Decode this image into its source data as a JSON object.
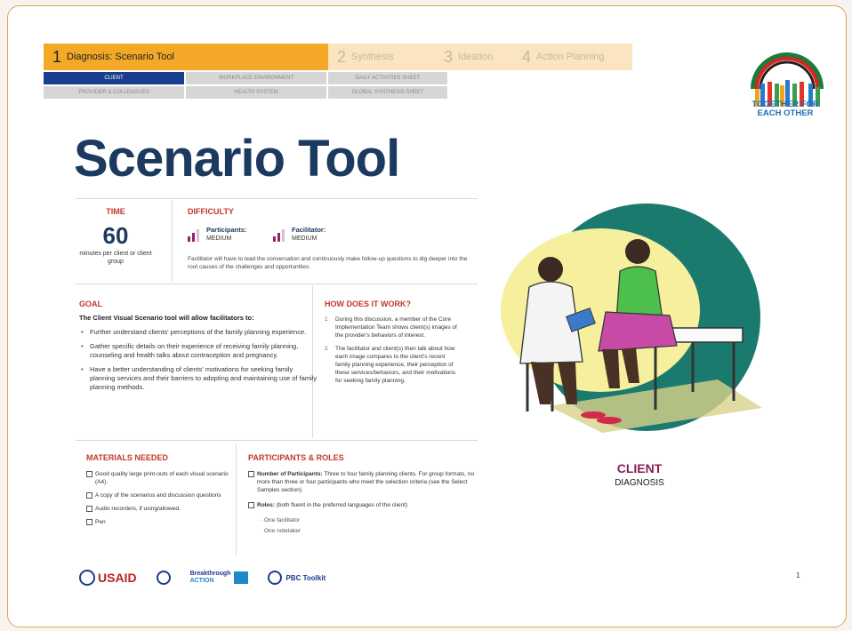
{
  "nav": {
    "steps": [
      {
        "num": "1",
        "label": "Diagnosis: Scenario Tool"
      },
      {
        "num": "2",
        "label": "Synthesis"
      },
      {
        "num": "3",
        "label": "Ideation"
      },
      {
        "num": "4",
        "label": "Action Planning"
      }
    ],
    "tabs_row1": [
      "CLIENT",
      "WORKPLACE ENVIRONMENT",
      "DAILY ACTIVITIES SHEET"
    ],
    "tabs_row2": [
      "PROVIDER & COLLEAGUES",
      "HEALTH SYSTEM",
      "GLOBAL SYNTHESIS SHEET"
    ]
  },
  "logo": {
    "line1": "TOGETHER FOR",
    "line2": "EACH OTHER"
  },
  "title": "Scenario Tool",
  "time": {
    "label": "TIME",
    "value": "60",
    "unit": "minutes per client or client group"
  },
  "difficulty": {
    "label": "DIFFICULTY",
    "participants_label": "Participants:",
    "participants_level": "MEDIUM",
    "facilitator_label": "Facilitator:",
    "facilitator_level": "MEDIUM",
    "note": "Facilitator will have to lead the conversation and continuously make follow-up questions to dig deeper into the root causes of the challenges and opportunities."
  },
  "goal": {
    "label": "GOAL",
    "lead": "The Client Visual Scenario tool will allow facilitators to:",
    "items": [
      "Further understand clients' perceptions of the family planning experience.",
      "Gather specific details on their experience of receiving family planning, counseling and health talks about contraception and pregnancy.",
      "Have a better understanding of clients' motivations for seeking family planning services and their barriers to adopting and maintaining use of family planning methods."
    ]
  },
  "how": {
    "label": "HOW DOES IT WORK?",
    "items": [
      {
        "n": "1",
        "text": "During this discussion, a member of the Core Implementation Team shows client(s) images of the provider's behaviors of interest."
      },
      {
        "n": "2",
        "text": "The facilitator and client(s) then talk about how each image compares to the client's recent family planning experience, their perception of these services/behaviors, and their motivations for seeking family planning."
      }
    ]
  },
  "materials": {
    "label": "MATERIALS NEEDED",
    "items": [
      "Good quality large print-outs of each visual scenario (A4).",
      "A copy of the scenarios and discussion questions",
      "Audio recorders, if using/allowed.",
      "Pen"
    ]
  },
  "participants": {
    "label": "PARTICIPANTS & ROLES",
    "number_label": "Number of Participants:",
    "number_text": "Three to four family planning clients. For group formats, no more than three or four participants who meet the selection criteria (see the Select Samples section).",
    "roles_label": "Roles:",
    "roles_text": "(both fluent in the preferred languages of the client)",
    "roles": [
      "One facilitator",
      "One notetaker"
    ]
  },
  "illustration": {
    "label": "CLIENT",
    "sublabel": "DIAGNOSIS"
  },
  "footer": {
    "usaid": "USAID",
    "breakthrough_1": "Breakthrough",
    "breakthrough_2": "ACTION",
    "pbc": "PBC Toolkit",
    "page": "1"
  },
  "colors": {
    "accent": "#f4a827",
    "navy": "#1c3a5f",
    "red": "#c0392b",
    "magenta": "#8b1e5a",
    "teal": "#1b7a6e",
    "yellow": "#f5ef9e"
  }
}
